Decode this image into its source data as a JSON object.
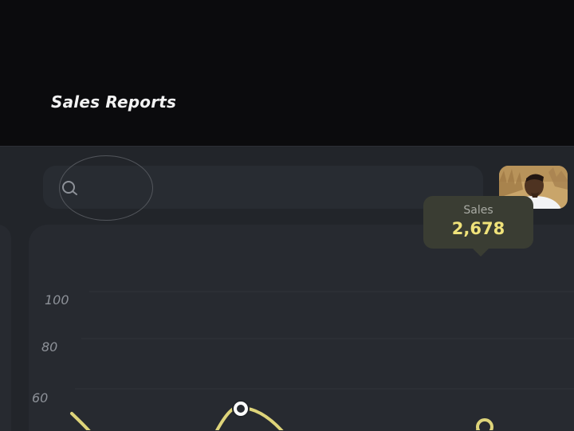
{
  "colors": {
    "background": "#0b0b0d",
    "panel": "#22252a",
    "card": "#272a30",
    "accent_line": "#ded47a",
    "accent_value": "#efe27a"
  },
  "search": {
    "icon": "search-icon"
  },
  "user": {
    "avatar": "avatar"
  },
  "report": {
    "title": "Sales Reports"
  },
  "tooltip": {
    "label": "Sales",
    "value": "2,678"
  },
  "chart_data": {
    "type": "line",
    "yticks": [
      "100",
      "80",
      "60"
    ],
    "grid": true
  }
}
